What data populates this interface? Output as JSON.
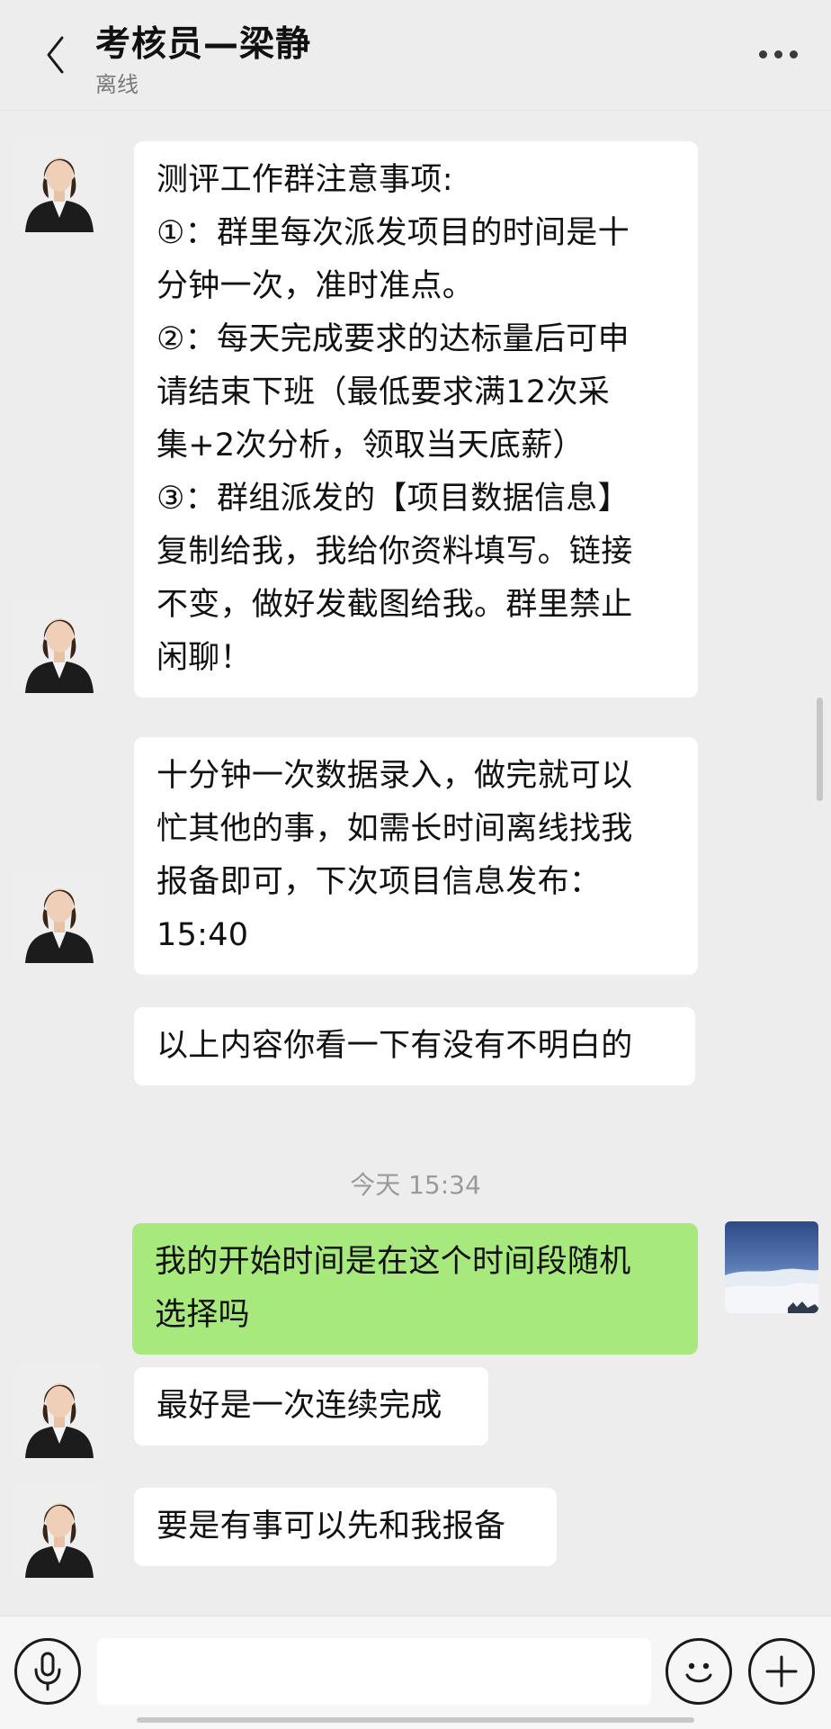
{
  "header": {
    "title": "考核员—梁静",
    "status": "离线"
  },
  "messages": [
    {
      "side": "left",
      "lines": [
        "测评工作群注意事项:",
        "①：群里每次派发项目的时间是十",
        "分钟一次，准时准点。",
        "②：每天完成要求的达标量后可申",
        "请结束下班（最低要求满12次采",
        "集+2次分析，领取当天底薪）",
        "③：群组派发的【项目数据信息】",
        "复制给我，我给你资料填写。链接",
        "不变，做好发截图给我。群里禁止",
        "闲聊！"
      ]
    },
    {
      "side": "left",
      "lines": [
        "十分钟一次数据录入，做完就可以",
        "忙其他的事，如需长时间离线找我",
        "报备即可，下次项目信息发布：",
        "15:40"
      ]
    },
    {
      "side": "left",
      "lines": [
        "以上内容你看一下有没有不明白的"
      ]
    },
    {
      "side": "right",
      "lines": [
        "我的开始时间是在这个时间段随机",
        "选择吗"
      ]
    },
    {
      "side": "left",
      "lines": [
        "最好是一次连续完成"
      ]
    },
    {
      "side": "left",
      "lines": [
        "要是有事可以先和我报备"
      ]
    }
  ],
  "timestamp": "今天 15:34",
  "input": {
    "value": ""
  },
  "icons": {
    "back": "chevron-left-icon",
    "more": "more-icon",
    "voice": "microphone-icon",
    "emoji": "emoji-icon",
    "add": "plus-icon"
  },
  "colors": {
    "background": "#ededed",
    "incoming_bubble": "#ffffff",
    "outgoing_bubble": "#a8e97e"
  }
}
